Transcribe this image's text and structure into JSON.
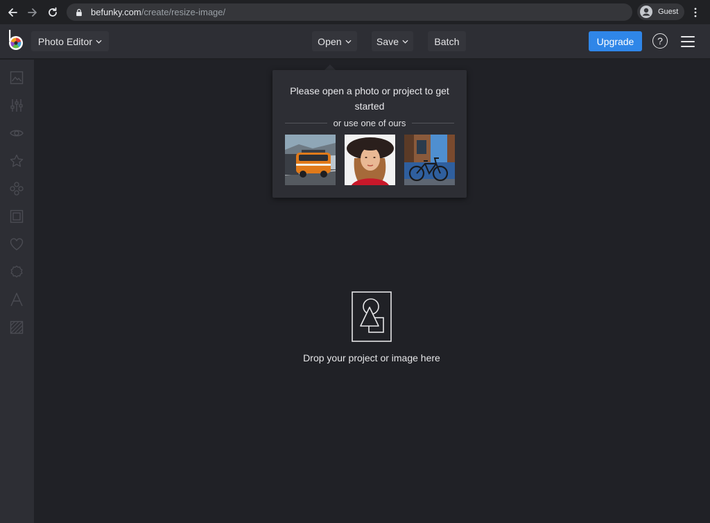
{
  "browser": {
    "url_host": "befunky.com",
    "url_path": "/create/resize-image/",
    "profile_label": "Guest",
    "icons": [
      "back-arrow-icon",
      "forward-arrow-icon",
      "reload-icon",
      "lock-icon",
      "avatar-icon",
      "kebab-menu-icon"
    ]
  },
  "appbar": {
    "product_menu_label": "Photo Editor",
    "open_label": "Open",
    "save_label": "Save",
    "batch_label": "Batch",
    "upgrade_label": "Upgrade",
    "help_label": "?",
    "colors": {
      "upgrade_bg": "#2f86e8",
      "bar_bg": "#2d2e34"
    }
  },
  "sidebar": {
    "items": [
      {
        "icon": "image-icon"
      },
      {
        "icon": "sliders-icon"
      },
      {
        "icon": "eye-icon"
      },
      {
        "icon": "star-icon"
      },
      {
        "icon": "graphics-icon"
      },
      {
        "icon": "frame-icon"
      },
      {
        "icon": "heart-icon"
      },
      {
        "icon": "badge-icon"
      },
      {
        "icon": "text-icon"
      },
      {
        "icon": "texture-icon"
      }
    ]
  },
  "popover": {
    "title": "Please open a photo or project to get started",
    "divider_text": "or use one of ours",
    "samples": [
      {
        "name": "orange-van-photo"
      },
      {
        "name": "woman-in-hat-photo"
      },
      {
        "name": "bicycle-photo"
      }
    ]
  },
  "dropzone": {
    "text": "Drop your project or image here"
  },
  "colors": {
    "canvas_bg": "#202126",
    "panel_bg": "#2d2e34",
    "accent": "#2f86e8"
  }
}
